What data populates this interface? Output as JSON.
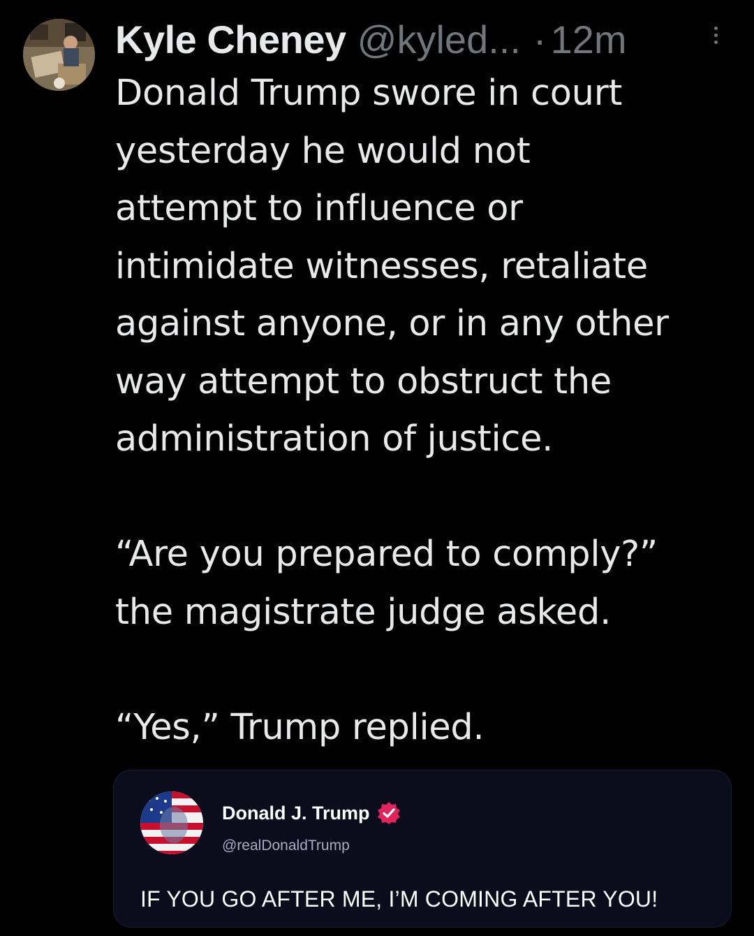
{
  "tweet": {
    "author": {
      "name": "Kyle Cheney",
      "handle": "@kyled...",
      "separator": "·",
      "time": "12m"
    },
    "body": {
      "paragraph_1": "Donald Trump swore in court\nyesterday he would not\nattempt to influence or\nintimidate witnesses, retaliate\nagainst anyone, or in any other\nway attempt to obstruct the\nadministration of justice.",
      "paragraph_2": "“Are you prepared to comply?”\nthe magistrate judge asked.",
      "paragraph_3": "“Yes,” Trump replied."
    },
    "icons": {
      "more": "more-vertical-icon",
      "verified": "verified-badge-icon"
    }
  },
  "quoted_post": {
    "name": "Donald J. Trump",
    "handle": "@realDonaldTrump",
    "text": "IF YOU GO AFTER ME, I’M COMING AFTER YOU!",
    "verified_color": "#e0245e"
  },
  "colors": {
    "background": "#000000",
    "primary_text": "#e7e9ea",
    "secondary_text": "#71767b",
    "card_background": "#0c0d1c"
  }
}
